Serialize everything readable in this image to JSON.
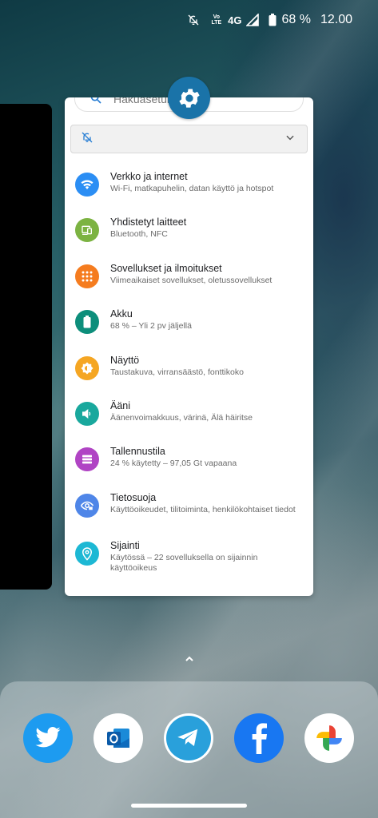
{
  "status_bar": {
    "volte_top": "Vo",
    "volte_bottom": "LTE",
    "network": "4G",
    "battery": "68 %",
    "time": "12.00"
  },
  "settings": {
    "search_placeholder": "Hakuasetuk",
    "items": [
      {
        "title": "Verkko ja internet",
        "subtitle": "Wi-Fi, matkapuhelin, datan käyttö ja hotspot",
        "icon": "wifi-icon",
        "color": "#2b8ef4"
      },
      {
        "title": "Yhdistetyt laitteet",
        "subtitle": "Bluetooth, NFC",
        "icon": "devices-icon",
        "color": "#7cb342"
      },
      {
        "title": "Sovellukset ja ilmoitukset",
        "subtitle": "Viimeaikaiset sovellukset, oletussovellukset",
        "icon": "apps-icon",
        "color": "#f57c1f"
      },
      {
        "title": "Akku",
        "subtitle": "68 % – Yli 2 pv jäljellä",
        "icon": "battery-icon",
        "color": "#0d8e7b"
      },
      {
        "title": "Näyttö",
        "subtitle": "Taustakuva, virransäästö, fonttikoko",
        "icon": "brightness-icon",
        "color": "#f5a623"
      },
      {
        "title": "Ääni",
        "subtitle": "Äänenvoimakkuus, värinä, Älä häiritse",
        "icon": "volume-icon",
        "color": "#19a89d"
      },
      {
        "title": "Tallennustila",
        "subtitle": "24 % käytetty – 97,05 Gt vapaana",
        "icon": "storage-icon",
        "color": "#b044c4"
      },
      {
        "title": "Tietosuoja",
        "subtitle": "Käyttöoikeudet, tilitoiminta, henkilökohtaiset tiedot",
        "icon": "privacy-icon",
        "color": "#4f86e8"
      },
      {
        "title": "Sijainti",
        "subtitle": "Käytössä – 22 sovelluksella on sijainnin käyttöoikeus",
        "icon": "location-icon",
        "color": "#1db8d4"
      }
    ]
  },
  "dock": {
    "apps": [
      "twitter",
      "outlook",
      "telegram",
      "facebook",
      "photos"
    ]
  },
  "colors": {
    "accent": "#1a73a8"
  }
}
